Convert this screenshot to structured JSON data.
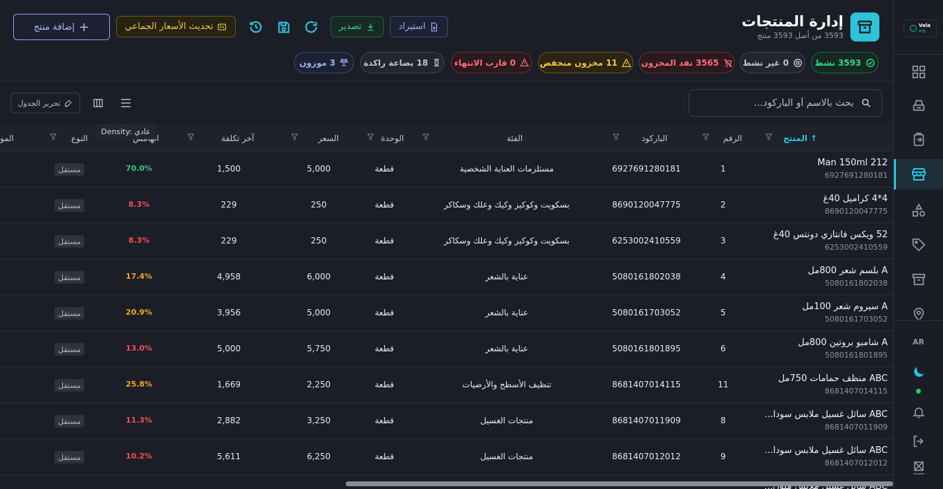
{
  "app": {
    "logo_name": "Vela",
    "logo_sub": "POS",
    "lang": "AR"
  },
  "header": {
    "title": "إدارة المنتجات",
    "subtitle": "3593 من أصل 3593 منتج",
    "buttons": {
      "import": "استيراد",
      "export": "تصدير",
      "bulk_price": "تحديث الأسعار الجماعي",
      "add_product": "إضافة منتج"
    }
  },
  "stats": {
    "active": "3593 نشط",
    "inactive": "0 غير نشط",
    "out_of_stock": "3565 نفد المخزون",
    "low_stock": "11 مخزون منخفض",
    "near_expiry": "0 قارب الانتهاء",
    "stagnant": "18 بضاعة راكدة",
    "weighed": "3 موزون"
  },
  "toolbar": {
    "search_placeholder": "بحث بالاسم أو الباركود...",
    "edit_table": "تحرير الجدول",
    "density_tooltip": "Density: عادي"
  },
  "table": {
    "columns": {
      "product": "المنتج",
      "number": "الرقم",
      "barcode": "الباركود",
      "category": "الفئة",
      "unit": "الوحدة",
      "price": "السعر",
      "last_cost": "آخر تكلفة",
      "margin": "الهامش",
      "type": "النوع",
      "extra": "المو"
    },
    "rows": [
      {
        "name": "Man 150ml 212",
        "barcode": "6927691280181",
        "number": "1",
        "category": "مستلزمات العناية الشخصية",
        "unit": "قطعة",
        "price": "5,000",
        "cost": "1,500",
        "margin": "70.0%",
        "type": "مستقل"
      },
      {
        "name": "4*4 كراميل 40غ",
        "barcode": "8690120047775",
        "number": "2",
        "category": "بسكويت وكوكيز وكيك وعلك وسكاكر",
        "unit": "قطعة",
        "price": "250",
        "cost": "229",
        "margin": "8.3%",
        "type": "مستقل"
      },
      {
        "name": "52 ويكس فانتازي دونتس 40غ",
        "barcode": "6253002410559",
        "number": "3",
        "category": "بسكويت وكوكيز وكيك وعلك وسكاكر",
        "unit": "قطعة",
        "price": "250",
        "cost": "229",
        "margin": "8.3%",
        "type": "مستقل"
      },
      {
        "name": "A بلسم شعر 800مل",
        "barcode": "5080161802038",
        "number": "4",
        "category": "عناية بالشعر",
        "unit": "قطعة",
        "price": "6,000",
        "cost": "4,958",
        "margin": "17.4%",
        "type": "مستقل"
      },
      {
        "name": "A سيروم شعر 100مل",
        "barcode": "5080161703052",
        "number": "5",
        "category": "عناية بالشعر",
        "unit": "قطعة",
        "price": "5,000",
        "cost": "3,956",
        "margin": "20.9%",
        "type": "مستقل"
      },
      {
        "name": "A شامبو بروتين 800مل",
        "barcode": "5080161801895",
        "number": "6",
        "category": "عناية بالشعر",
        "unit": "قطعة",
        "price": "5,750",
        "cost": "5,000",
        "margin": "13.0%",
        "type": "مستقل"
      },
      {
        "name": "ABC منظف حمامات 750مل",
        "barcode": "8681407014115",
        "number": "11",
        "category": "تنظيف الأسطح والأرضيات",
        "unit": "قطعة",
        "price": "2,250",
        "cost": "1,669",
        "margin": "25.8%",
        "type": "مستقل"
      },
      {
        "name": "ABC سائل غسيل ملابس سودا...",
        "barcode": "8681407011909",
        "number": "8",
        "category": "منتجات الغسيل",
        "unit": "قطعة",
        "price": "3,250",
        "cost": "2,882",
        "margin": "11.3%",
        "type": "مستقل"
      },
      {
        "name": "ABC سائل غسيل ملابس سودا...",
        "barcode": "8681407012012",
        "number": "9",
        "category": "منتجات الغسيل",
        "unit": "قطعة",
        "price": "6,250",
        "cost": "5,611",
        "margin": "10.2%",
        "type": "مستقل"
      },
      {
        "name": "ABC سائل غسيل ملابس ملون...",
        "barcode": "",
        "number": "",
        "category": "",
        "unit": "",
        "price": "",
        "cost": "",
        "margin": "",
        "type": ""
      }
    ]
  },
  "colors": {
    "accent": "#29c4e0",
    "margin_high": "#2ec98a",
    "margin_mid": "#f5a524",
    "margin_low": "#f04e5e"
  }
}
